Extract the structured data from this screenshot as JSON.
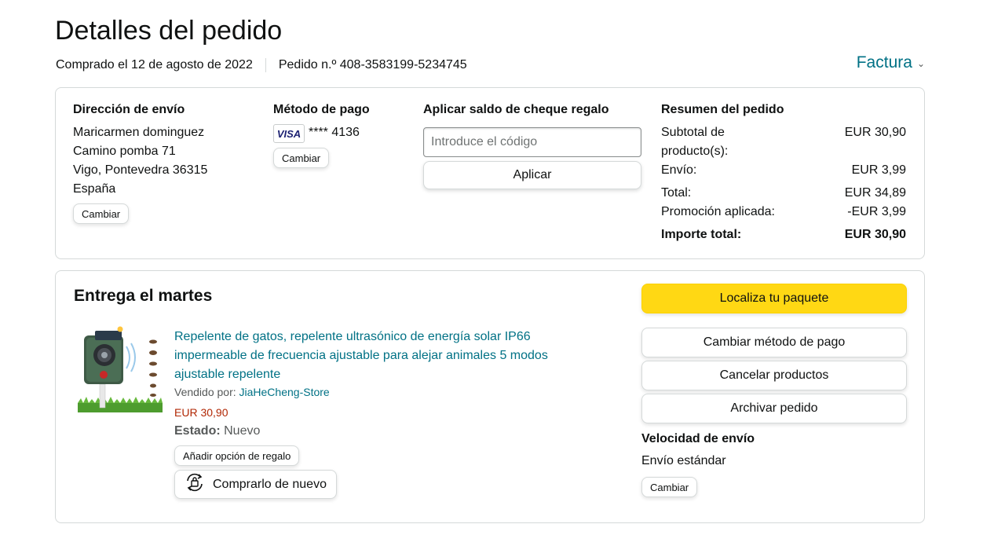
{
  "header": {
    "title": "Detalles del pedido",
    "purchase_date": "Comprado el 12 de agosto de 2022",
    "order_number": "Pedido n.º 408-3583199-5234745",
    "invoice_label": "Factura"
  },
  "shipping": {
    "heading": "Dirección de envío",
    "name": "Maricarmen dominguez",
    "street": "Camino pomba 71",
    "city": "Vigo, Pontevedra 36315",
    "country": "España",
    "change_label": "Cambiar"
  },
  "payment": {
    "heading": "Método de pago",
    "card_brand": "VISA",
    "card_number": "**** 4136",
    "change_label": "Cambiar"
  },
  "gift": {
    "heading": "Aplicar saldo de cheque regalo",
    "placeholder": "Introduce el código",
    "apply_label": "Aplicar"
  },
  "summary": {
    "heading": "Resumen del pedido",
    "subtotal_label_1": "Subtotal de",
    "subtotal_label_2": "producto(s):",
    "subtotal_value": "EUR 30,90",
    "shipping_label": "Envío:",
    "shipping_value": "EUR 3,99",
    "total_label": "Total:",
    "total_value": "EUR 34,89",
    "promo_label": "Promoción aplicada:",
    "promo_value": "-EUR 3,99",
    "grand_label": "Importe total:",
    "grand_value": "EUR 30,90"
  },
  "delivery": {
    "title": "Entrega el martes",
    "product_title": "Repelente de gatos, repelente ultrasónico de energía solar IP66 impermeable de frecuencia ajustable para alejar animales 5 modos ajustable repelente",
    "seller_prefix": "Vendido por:",
    "seller_name": "JiaHeCheng-Store",
    "price": "EUR 30,90",
    "condition_label": "Estado:",
    "condition_value": "Nuevo",
    "gift_option_label": "Añadir opción de regalo",
    "buy_again_label": "Comprarlo de nuevo"
  },
  "actions": {
    "track_label": "Localiza tu paquete",
    "change_payment_label": "Cambiar método de pago",
    "cancel_label": "Cancelar productos",
    "archive_label": "Archivar pedido",
    "speed_heading": "Velocidad de envío",
    "speed_value": "Envío estándar",
    "speed_change_label": "Cambiar"
  },
  "colors": {
    "link": "#007185",
    "price": "#b12704",
    "primary_button": "#ffd814"
  }
}
